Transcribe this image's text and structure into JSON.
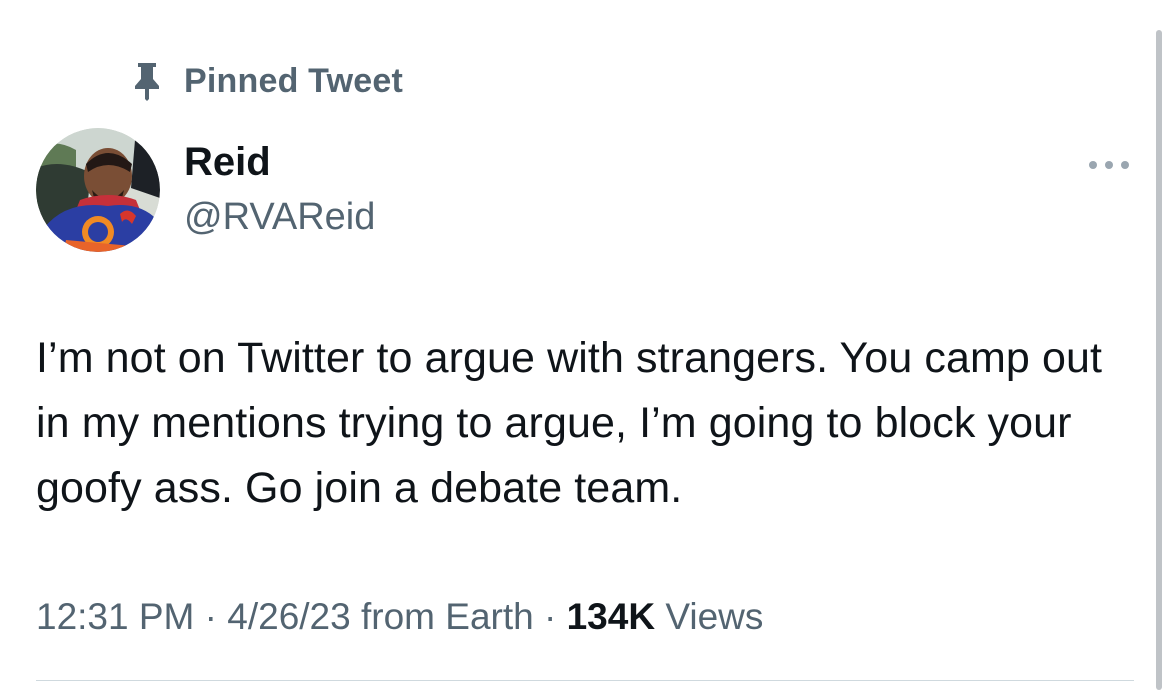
{
  "pinned": {
    "label": "Pinned Tweet",
    "icon": "pin-icon"
  },
  "author": {
    "display_name": "Reid",
    "handle": "@RVAReid",
    "avatar_icon": "avatar-photo"
  },
  "more_icon": "more-dots-icon",
  "tweet": {
    "text": "I’m not on Twitter to argue with strangers. You camp out in my mentions trying to argue, I’m going to block your goofy ass. Go join a debate team."
  },
  "meta": {
    "time": "12:31 PM",
    "separator1": " · ",
    "date": "4/26/23",
    "source": " from Earth",
    "separator2": " · ",
    "views_count": "134K",
    "views_label": " Views"
  },
  "colors": {
    "primary_text": "#0f1419",
    "secondary_text": "#536471",
    "divider": "#cfd9de"
  }
}
